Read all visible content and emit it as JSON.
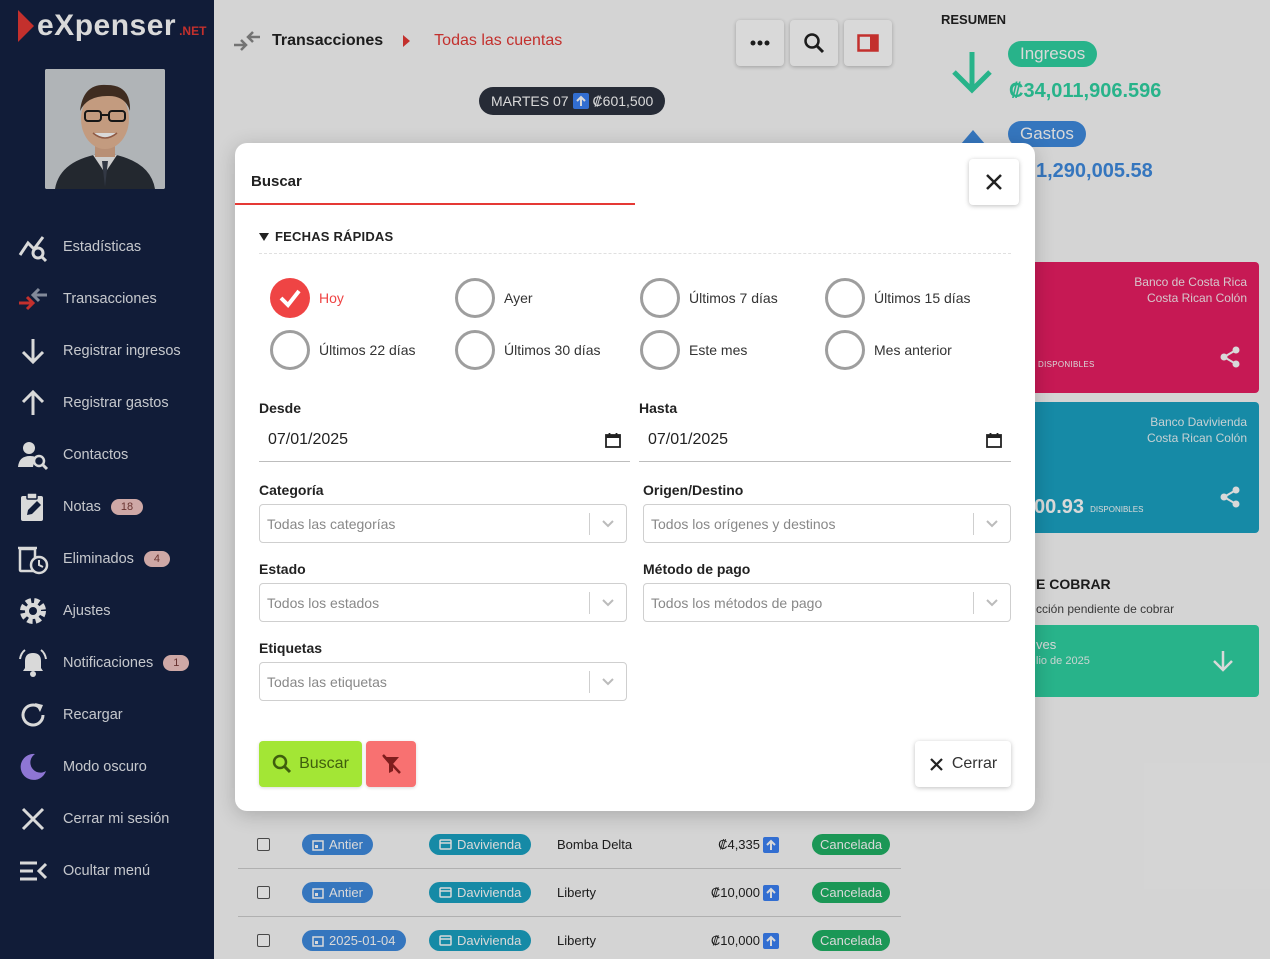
{
  "app": {
    "logo_text": "eXpenser",
    "logo_suffix": ".NET"
  },
  "sidebar": {
    "items": [
      {
        "label": "Estadísticas",
        "icon": "chart-search-icon"
      },
      {
        "label": "Transacciones",
        "icon": "transactions-icon"
      },
      {
        "label": "Registrar ingresos",
        "icon": "arrow-down-icon"
      },
      {
        "label": "Registrar gastos",
        "icon": "arrow-up-icon"
      },
      {
        "label": "Contactos",
        "icon": "contact-search-icon"
      },
      {
        "label": "Notas",
        "icon": "note-edit-icon",
        "badge": "18"
      },
      {
        "label": "Eliminados",
        "icon": "deleted-clock-icon",
        "badge": "4"
      },
      {
        "label": "Ajustes",
        "icon": "gear-icon"
      },
      {
        "label": "Notificaciones",
        "icon": "bell-icon",
        "badge": "1"
      },
      {
        "label": "Recargar",
        "icon": "refresh-icon"
      },
      {
        "label": "Modo oscuro",
        "icon": "moon-icon"
      },
      {
        "label": "Cerrar mi sesión",
        "icon": "close-icon"
      },
      {
        "label": "Ocultar menú",
        "icon": "collapse-menu-icon"
      }
    ]
  },
  "header": {
    "section": "Transacciones",
    "filter": "Todas las cuentas",
    "date_chip": {
      "day": "MARTES 07",
      "amount": "₡601,500"
    }
  },
  "summary": {
    "title": "RESUMEN",
    "income_label": "Ingresos",
    "income_amount": "₡34,011,906.596",
    "expense_label": "Gastos",
    "expense_amount": "1,290,005.58"
  },
  "accounts": [
    {
      "bank": "Banco de Costa Rica",
      "currency": "Costa Rican Colón",
      "available": "DISPONIBLES",
      "amount": "",
      "color": "#e91e63"
    },
    {
      "bank": "Banco Davivienda",
      "currency": "Costa Rican Colón",
      "available": "DISPONIBLES",
      "amount": "00.93",
      "color": "#1ba3c3"
    }
  ],
  "cobrar": {
    "title": "E COBRAR",
    "subtitle": "cción pendiente de cobrar",
    "card_title": "ves",
    "card_sub": "lio de 2025"
  },
  "rows": [
    {
      "date": "Antier",
      "bank": "Davivienda",
      "desc": "Bomba Delta",
      "amount": "₡4,335",
      "status": "Cancelada"
    },
    {
      "date": "Antier",
      "bank": "Davivienda",
      "desc": "Liberty",
      "amount": "₡10,000",
      "status": "Cancelada"
    },
    {
      "date": "2025-01-04",
      "bank": "Davivienda",
      "desc": "Liberty",
      "amount": "₡10,000",
      "status": "Cancelada"
    }
  ],
  "modal": {
    "title": "Buscar",
    "quick_dates_label": "FECHAS RÁPIDAS",
    "quick_dates": [
      {
        "label": "Hoy",
        "checked": true
      },
      {
        "label": "Ayer",
        "checked": false
      },
      {
        "label": "Últimos 7 días",
        "checked": false
      },
      {
        "label": "Últimos 15 días",
        "checked": false
      },
      {
        "label": "Últimos 22 días",
        "checked": false
      },
      {
        "label": "Últimos 30 días",
        "checked": false
      },
      {
        "label": "Este mes",
        "checked": false
      },
      {
        "label": "Mes anterior",
        "checked": false
      }
    ],
    "from_label": "Desde",
    "from_value": "07/01/2025",
    "to_label": "Hasta",
    "to_value": "07/01/2025",
    "category_label": "Categoría",
    "category_placeholder": "Todas las categorías",
    "origin_label": "Origen/Destino",
    "origin_placeholder": "Todos los orígenes y destinos",
    "status_label": "Estado",
    "status_placeholder": "Todos los estados",
    "payment_label": "Método de pago",
    "payment_placeholder": "Todos los métodos de pago",
    "tags_label": "Etiquetas",
    "tags_placeholder": "Todas las etiquetas",
    "search_button": "Buscar",
    "close_button": "Cerrar"
  },
  "colors": {
    "accent": "#e53935",
    "sidebar": "#142242",
    "income": "#2fd3a3",
    "expense": "#3f8be0",
    "search_btn": "#a3e635",
    "clear_btn": "#f87171"
  }
}
